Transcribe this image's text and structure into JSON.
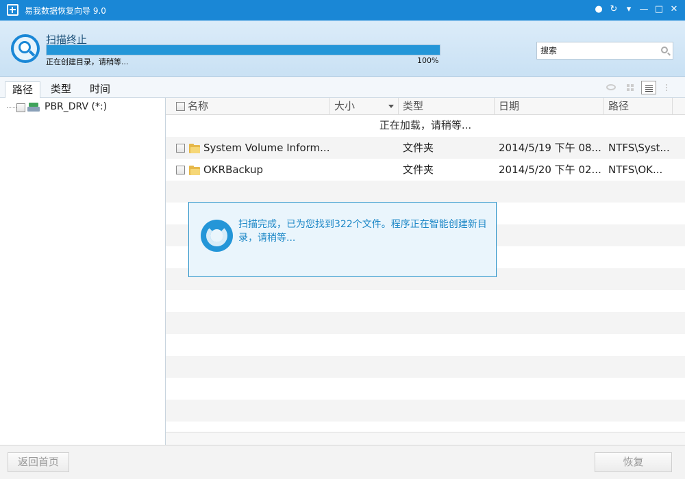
{
  "window": {
    "title": "易我数据恢复向导 9.0"
  },
  "header": {
    "status": "扫描终止",
    "sub_status": "正在创建目录，请稍等...",
    "progress_label": "100%",
    "progress_fraction": 1.0,
    "search_placeholder": "搜索"
  },
  "tabs": [
    {
      "label": "路径"
    },
    {
      "label": "类型"
    },
    {
      "label": "时间"
    }
  ],
  "tree": {
    "drive_label": "PBR_DRV (*:)"
  },
  "columns": {
    "name": "名称",
    "size": "大小",
    "type": "类型",
    "date": "日期",
    "path": "路径"
  },
  "loading_text": "正在加载，请稍等...",
  "rows": [
    {
      "name": "System Volume Inform...",
      "type": "文件夹",
      "date": "2014/5/19 下午 08...",
      "path": "NTFS\\Syst..."
    },
    {
      "name": "OKRBackup",
      "type": "文件夹",
      "date": "2014/5/20 下午 02...",
      "path": "NTFS\\OK..."
    }
  ],
  "dialog": {
    "message": "扫描完成，已为您找到322个文件。程序正在智能创建新目录，请稍等..."
  },
  "buttons": {
    "back_home": "返回首页",
    "recover": "恢复"
  },
  "colors": {
    "title_bar": "#1a87d6",
    "accent": "#2496d8",
    "dialog_text": "#1a86c6"
  }
}
